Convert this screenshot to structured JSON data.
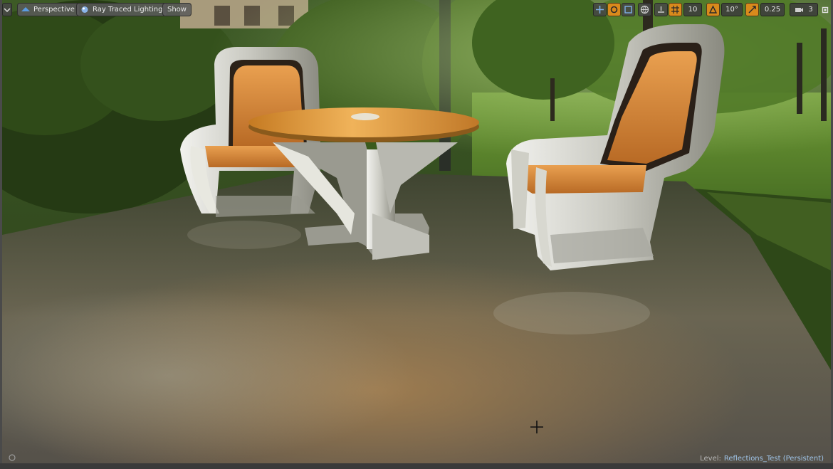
{
  "toolbar": {
    "menu_icon": "chevron-down-icon",
    "perspective_label": "Perspective",
    "lighting_label": "Ray Traced Lighting",
    "show_label": "Show",
    "grid_snap_value": "10",
    "rotation_snap_value": "10°",
    "scale_snap_value": "0.25",
    "camera_speed_value": "3"
  },
  "status_bar": {
    "level_label": "Level:",
    "level_name": "Reflections_Test (Persistent)"
  },
  "colors": {
    "accent": "#d98a1c",
    "floor": "#5a5a45",
    "grass": "#4f7a2a",
    "leather": "#d98a3a",
    "table_top": "#e0a040"
  },
  "scene_description": {
    "objects": [
      "chair-left",
      "round-table",
      "chair-right",
      "floor-plane",
      "park-background"
    ]
  }
}
